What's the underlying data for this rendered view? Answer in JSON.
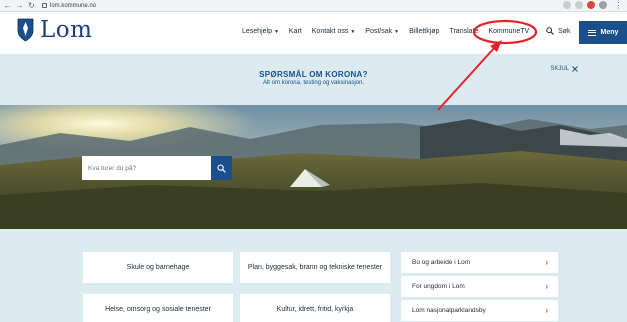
{
  "browser": {
    "url": "lom.kommune.no"
  },
  "header": {
    "logo_text": "Lom",
    "nav": [
      {
        "label": "Lesehjelp",
        "has_caret": true
      },
      {
        "label": "Kart",
        "has_caret": false
      },
      {
        "label": "Kontakt oss",
        "has_caret": true
      },
      {
        "label": "Post/sak",
        "has_caret": true
      },
      {
        "label": "Billettkjøp",
        "has_caret": false
      },
      {
        "label": "Translate",
        "has_caret": false
      },
      {
        "label": "KommuneTV",
        "has_caret": false
      }
    ],
    "search_label": "Søk",
    "menu_label": "Meny"
  },
  "banner": {
    "title": "SPØRSMÅL OM KORONA?",
    "subtitle": "Alt om korona, testing og vaksinasjon.",
    "hide_label": "SKJUL"
  },
  "hero": {
    "search_placeholder": "Kva turer du på?"
  },
  "cards": [
    {
      "label": "Skule og barnehage"
    },
    {
      "label": "Plan, byggesak, brann og tekniske tenester"
    },
    {
      "label": "Helse, omsorg og sosiale tenester"
    },
    {
      "label": "Kultur, idrett, fritid, kyrkja"
    }
  ],
  "links": [
    {
      "label": "Bu og arbeide i Lom"
    },
    {
      "label": "For ungdom i Lom"
    },
    {
      "label": "Lom nasjonalparklandsby"
    }
  ],
  "colors": {
    "brand_blue": "#1a4f8c",
    "banner_bg": "#dcebef",
    "annotation_red": "#e8202a"
  }
}
